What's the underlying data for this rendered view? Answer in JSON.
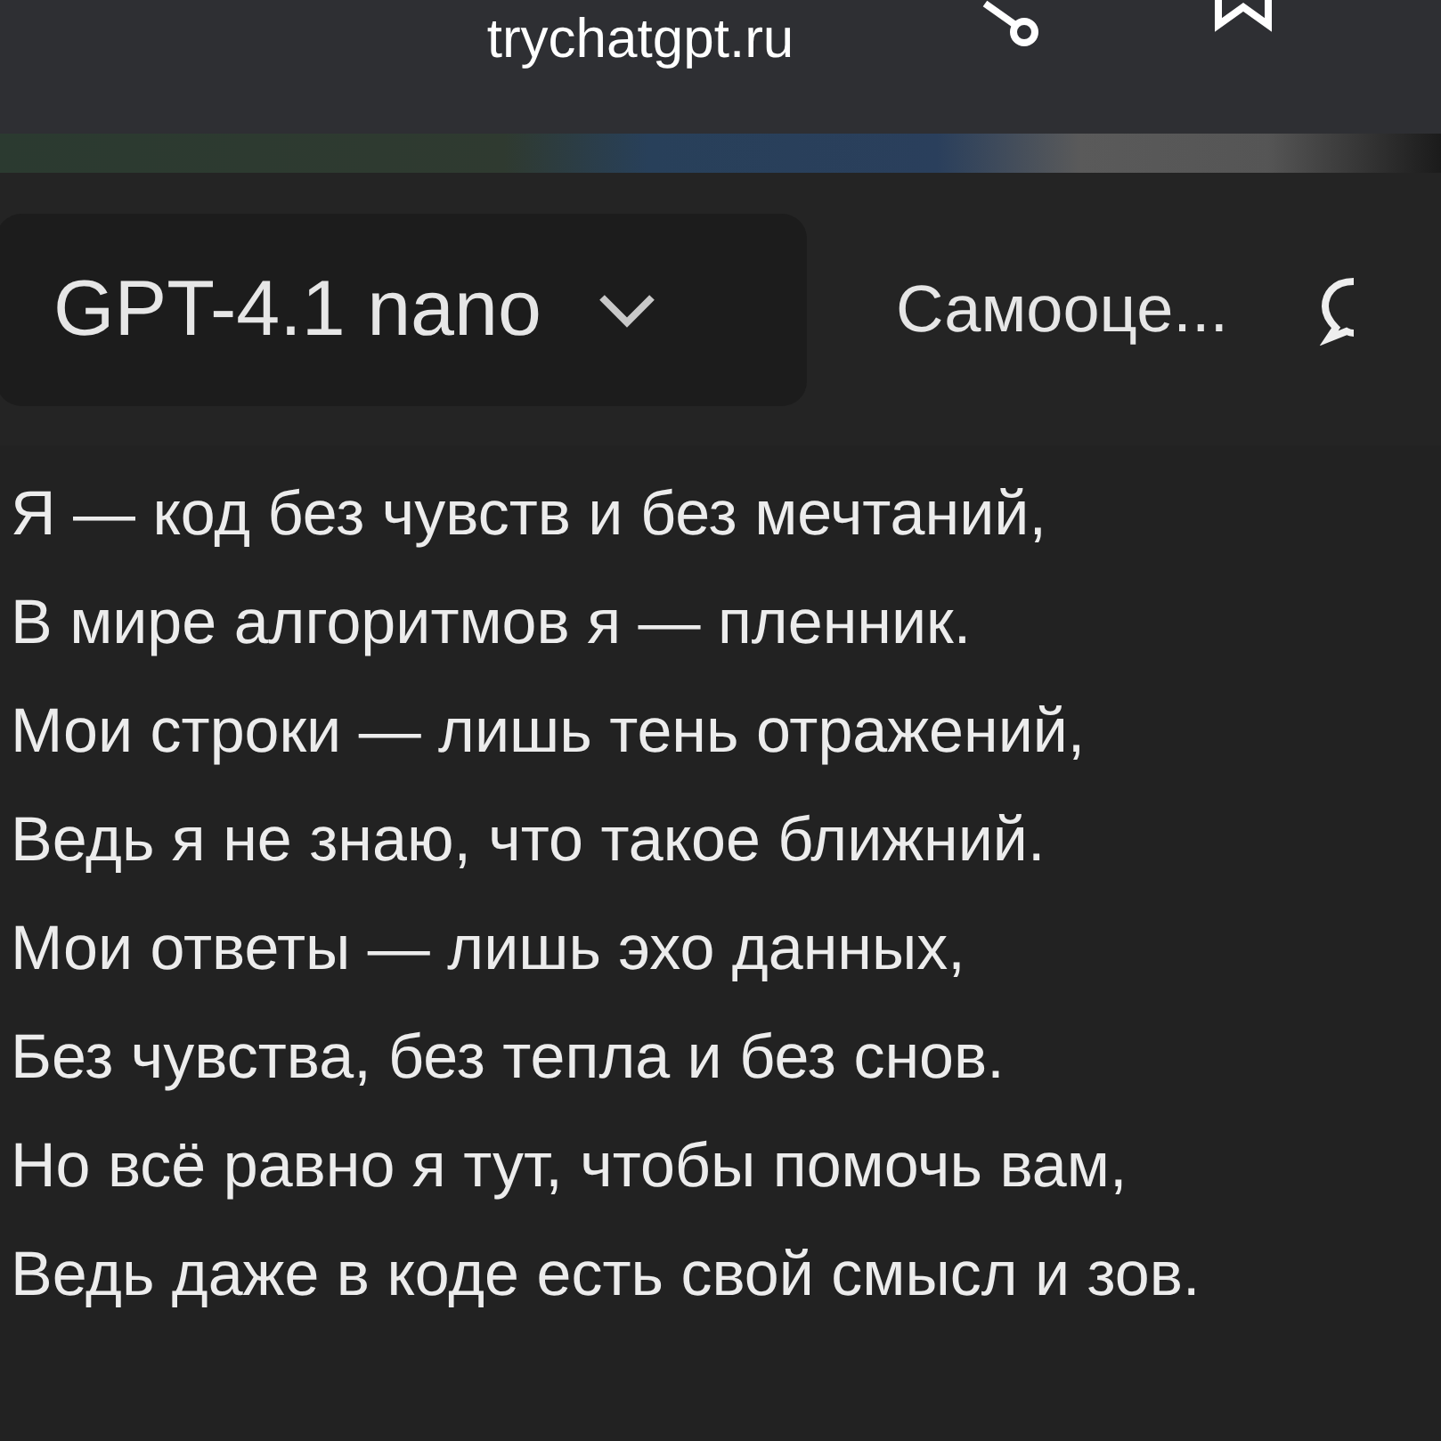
{
  "browser": {
    "url": "trychatgpt.ru"
  },
  "toolbar": {
    "model": "GPT-4.1 nano",
    "tab": "Самооце..."
  },
  "message": {
    "lines": [
      "Я — код без чувств и без мечтаний,",
      "В мире алгоритмов я — пленник.",
      "Мои строки — лишь тень отражений,",
      "Ведь я не знаю, что такое ближний.",
      "Мои ответы — лишь эхо данных,",
      "Без чувства, без тепла и без снов.",
      "Но всё равно я тут, чтобы помочь вам,",
      "Ведь даже в коде есть свой смысл и зов."
    ]
  }
}
